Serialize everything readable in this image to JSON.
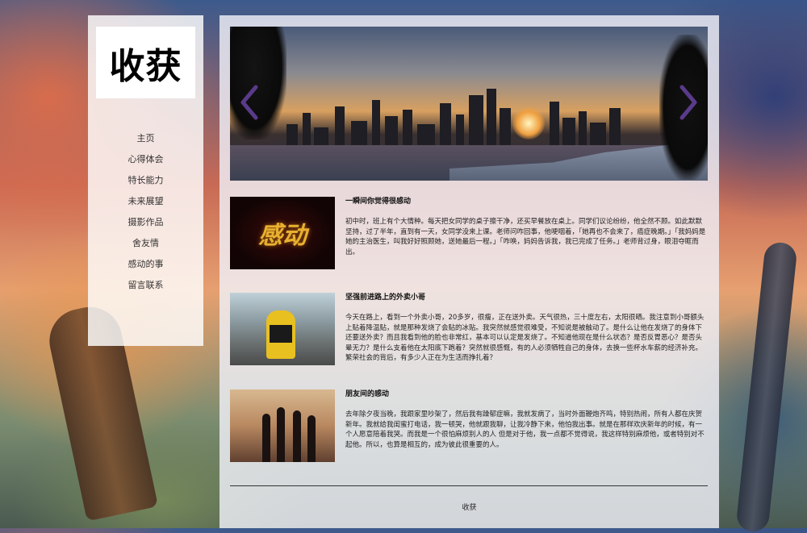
{
  "site": {
    "logo_text": "收获"
  },
  "nav": {
    "items": [
      {
        "label": "主页"
      },
      {
        "label": "心得体会"
      },
      {
        "label": "特长能力"
      },
      {
        "label": "未来展望"
      },
      {
        "label": "摄影作品"
      },
      {
        "label": "舍友情"
      },
      {
        "label": "感动的事"
      },
      {
        "label": "留言联系"
      }
    ]
  },
  "carousel": {
    "prev_icon": "chevron-left-icon",
    "next_icon": "chevron-right-icon",
    "accent": "#5a3a8a"
  },
  "articles": [
    {
      "title": "一瞬间你觉得很感动",
      "thumb_text": "感动",
      "body": "初中时，班上有个大情种。每天把女同学的桌子擦干净，还买早餐放在桌上。同学们议论纷纷，他全然不顾。如此默默坚持，过了半年，直到有一天，女同学没来上课。老师问咋回事，他哽咽着，「她再也不会来了，癌症晚期。」「我妈妈是她的主治医生，叫我好好照顾她，送她最后一程。」「咋唤，妈妈告诉我，我已完成了任务。」老师背过身，眼泪夺眶而出。"
    },
    {
      "title": "坚强前进路上的外卖小哥",
      "body": "今天在路上，看到一个外卖小哥，20多岁，很瘦，正在送外卖。天气很热，三十度左右，太阳很晒。我注意到小哥额头上贴着降温贴，就是那种发烧了会贴的冰贴。我突然就感觉很难受，不知说是被触动了。是什么让他在发烧了的身体下还要送外卖？而且我看到他的脸也非常红，基本可以认定是发烧了。不知道他现在是什么状态？是否反胃恶心？是否头晕无力？是什么支着他在太阳底下跑着？突然就很感慨，有的人必须牺牲自己的身体，去换一些杯水车薪的经济补充。繁荣社会的背后，有多少人正在为生活而挣扎着？"
    },
    {
      "title": "朋友间的感动",
      "body": "去年除夕夜当晚，我跟家里吵架了，然后我有躁郁症嘛，我就发病了，当时外面鞭炮齐鸣，特别热闹，所有人都在庆贺新年。我就给我闺蜜打电话，我一顿哭，他就跟我聊，让我冷静下来，他怕我出事。就是在那样欢庆新年的时候，有一个人愿意陪着我哭。而我是一个很怕麻烦别人的人 但是对于他，我一点都不觉得说，我这样特别麻烦他，或者特别对不起他。所以，也算是相互的，成为彼此很重要的人。"
    }
  ],
  "footer": {
    "text": "收获"
  }
}
